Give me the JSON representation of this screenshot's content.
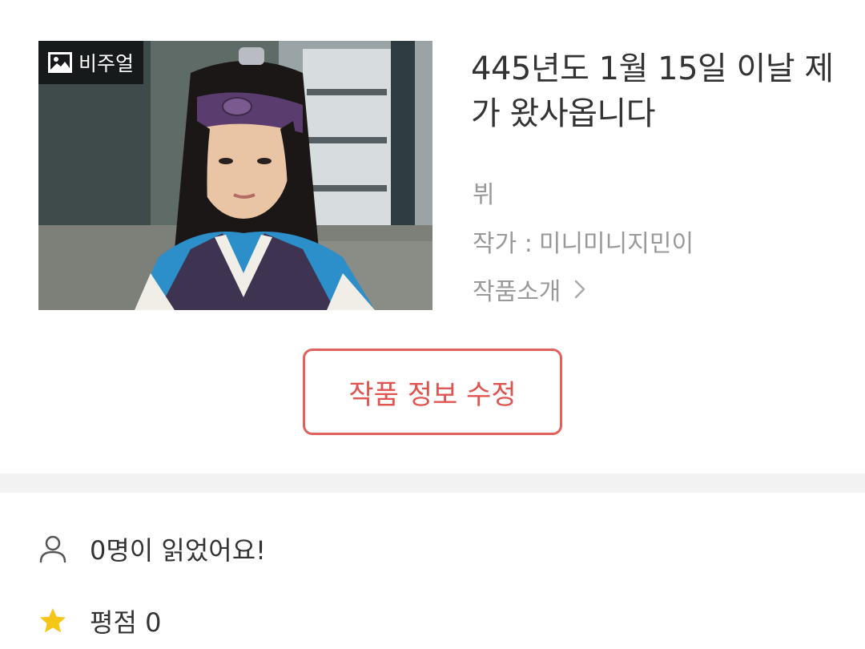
{
  "cover": {
    "badge_icon": "image-icon",
    "badge_label": "비주얼"
  },
  "work": {
    "title": "445년도 1월 15일 이날 제가 왔사옵니다",
    "genre": "뷔",
    "author_label": "작가 :",
    "author_name": "미니미니지민이",
    "intro_label": "작품소개",
    "intro_icon": "chevron-right-icon"
  },
  "actions": {
    "edit_label": "작품 정보 수정"
  },
  "stats": {
    "readers_icon": "person-icon",
    "readers_text": "0명이 읽었어요!",
    "rating_icon": "star-icon",
    "rating_label": "평점",
    "rating_value": "0"
  },
  "colors": {
    "accent": "#e0544f",
    "muted_text": "#999999",
    "primary_text": "#333333",
    "divider": "#f2f2f2",
    "star": "#f5c518"
  }
}
